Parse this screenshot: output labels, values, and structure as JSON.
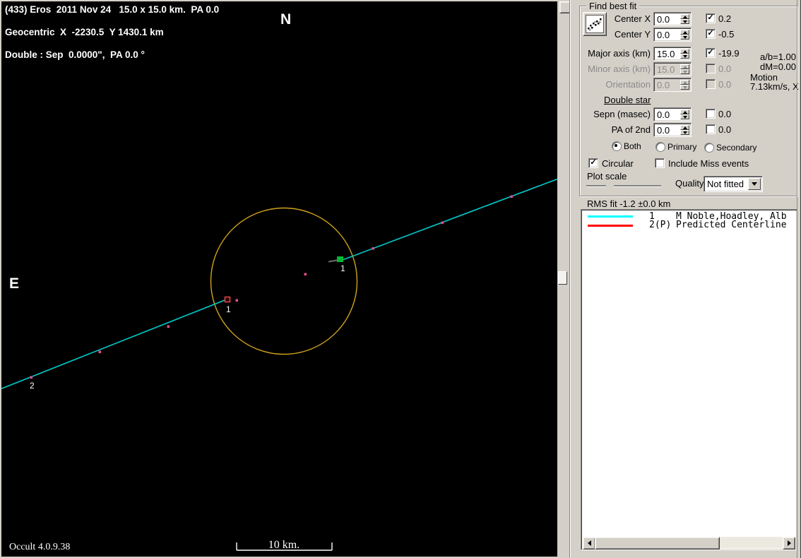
{
  "plot": {
    "info_line1": "(433) Eros  2011 Nov 24   15.0 x 15.0 km.  PA 0.0",
    "info_line2": "Geocentric  X  -2230.5  Y 1430.1 km",
    "info_line3": "Double : Sep  0.0000\",  PA 0.0 °",
    "north_label": "N",
    "east_label": "E",
    "scale_label": "10 km.",
    "version_label": "Occult 4.0.9.38",
    "chord1_disappearance_label": "1",
    "chord1_reappearance_label": "1",
    "chord2_label": "2",
    "colors": {
      "star_path": "#00cccc",
      "asteroid_limb": "#d2a41e",
      "time_tick": "#e34e8e",
      "disappearance_marker": "#00b835",
      "reappearance_marker": "#dd4444"
    }
  },
  "panel": {
    "group_title": "Find best fit",
    "rows": {
      "center_x": {
        "label": "Center X",
        "value": "0.0",
        "delta": "0.2"
      },
      "center_y": {
        "label": "Center Y",
        "value": "0.0",
        "delta": "-0.5"
      },
      "major_axis": {
        "label": "Major axis (km)",
        "value": "15.0",
        "delta": "-19.9"
      },
      "minor_axis": {
        "label": "Minor axis (km)",
        "value": "15.0",
        "delta": "0.0"
      },
      "orientation": {
        "label": "Orientation",
        "value": "0.0",
        "delta": "0.0"
      },
      "sepn": {
        "label": "Sepn (masec)",
        "value": "0.0",
        "delta": "0.0"
      },
      "pa_2nd": {
        "label": "PA of 2nd",
        "value": "0.0",
        "delta": "0.0"
      }
    },
    "stats": {
      "axis_ratio": "a/b=1.00",
      "dm": "dM=0.00",
      "motion_label": "Motion",
      "motion_value": "7.13km/s, X"
    },
    "double_star_label": "Double star",
    "radio_both": "Both",
    "radio_primary": "Primary",
    "radio_secondary": "Secondary",
    "circular_label": "Circular",
    "miss_events_label": "Include Miss events",
    "plot_scale_label": "Plot scale",
    "quality_label": "Quality",
    "quality_value": "Not fitted",
    "rms_label": "RMS fit -1.2 ±0.0 km"
  },
  "legend": {
    "rows": [
      {
        "color": "#00ffff",
        "id": "1",
        "name": "M Noble,Hoadley, Alb"
      },
      {
        "color": "#ff0000",
        "id": "2(P)",
        "name": "Predicted Centerline"
      }
    ]
  }
}
